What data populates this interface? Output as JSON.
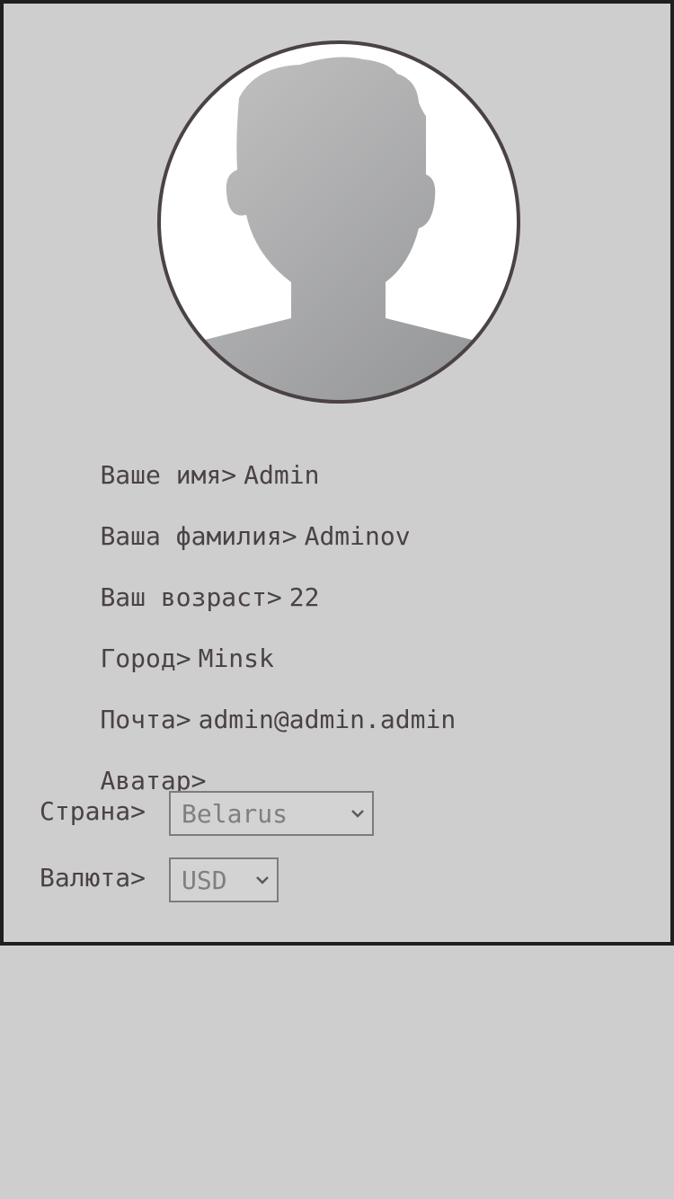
{
  "profile": {
    "fields": [
      {
        "label": "Ваше имя>",
        "value": "Admin"
      },
      {
        "label": "Ваша фамилия>",
        "value": "Adminov"
      },
      {
        "label": "Ваш возраст>",
        "value": "22"
      },
      {
        "label": "Город>",
        "value": "Minsk"
      },
      {
        "label": "Почта>",
        "value": "admin@admin.admin"
      },
      {
        "label": "Аватар>",
        "value": ""
      }
    ],
    "country": {
      "label": "Страна>",
      "selected": "Belarus"
    },
    "currency": {
      "label": "Валюта>",
      "selected": "USD"
    }
  },
  "icons": {
    "avatar": "user-silhouette-icon",
    "select_arrow": "chevron-down-icon"
  },
  "colors": {
    "background": "#cecece",
    "border": "#1f1f1f",
    "text": "#4a4244",
    "select_text": "#7f7f7f"
  }
}
